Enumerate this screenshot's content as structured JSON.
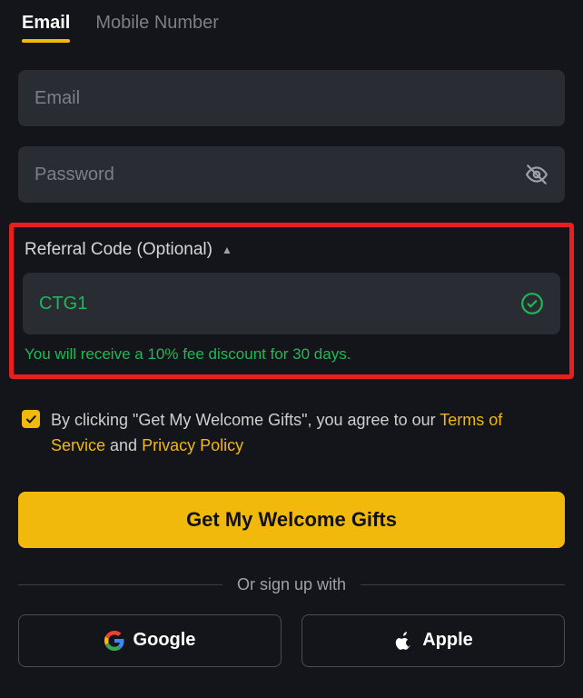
{
  "tabs": {
    "email": "Email",
    "mobile": "Mobile Number"
  },
  "fields": {
    "email_placeholder": "Email",
    "password_placeholder": "Password"
  },
  "referral": {
    "header": "Referral Code (Optional)",
    "value": "CTG1",
    "message": "You will receive a 10% fee discount for 30 days."
  },
  "agreement": {
    "prefix": "By clicking \"Get My Welcome Gifts\", you agree to our ",
    "tos": "Terms of Service",
    "joiner": " and ",
    "pp": "Privacy Policy"
  },
  "primary_button": "Get My Welcome Gifts",
  "or_label": "Or sign up with",
  "social": {
    "google": "Google",
    "apple": "Apple"
  }
}
